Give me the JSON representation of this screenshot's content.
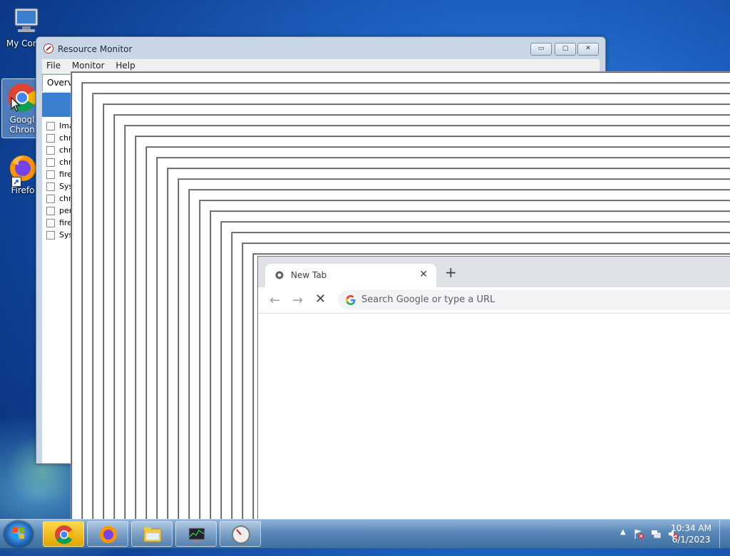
{
  "desktop": {
    "icons": [
      {
        "label": "My Computer",
        "visible_label": "My Comp"
      },
      {
        "label": "Google Chrome",
        "line1": "Googl",
        "line2": "Chron"
      },
      {
        "label": "Firefox",
        "visible_label": "Firefo"
      }
    ]
  },
  "resource_monitor": {
    "title": "Resource Monitor",
    "menu": [
      "File",
      "Monitor",
      "Help"
    ],
    "tab": "Overvi",
    "list_header": "Ima",
    "rows": [
      "chro",
      "chro",
      "chro",
      "firef",
      "Syst",
      "chro",
      "perf",
      "firef",
      "Syst"
    ],
    "buttons": {
      "minimize": "▭",
      "maximize": "▢",
      "close": "✕"
    }
  },
  "chrome": {
    "tab_title": "New Tab",
    "tab_close": "✕",
    "new_tab": "+",
    "back": "←",
    "forward": "→",
    "stop": "✕",
    "omnibox_placeholder": "Search Google or type a URL"
  },
  "taskbar": {
    "apps": [
      "chrome-icon",
      "firefox-icon",
      "file-explorer-icon",
      "resource-monitor-icon",
      "speedometer-icon"
    ],
    "tray_arrow": "▲",
    "time": "10:34 AM",
    "date": "6/1/2023"
  },
  "colors": {
    "desktop_bg": "#1d62c2",
    "chrome_tabstrip": "#dee1e6",
    "taskbar": "#5c8bbb"
  }
}
